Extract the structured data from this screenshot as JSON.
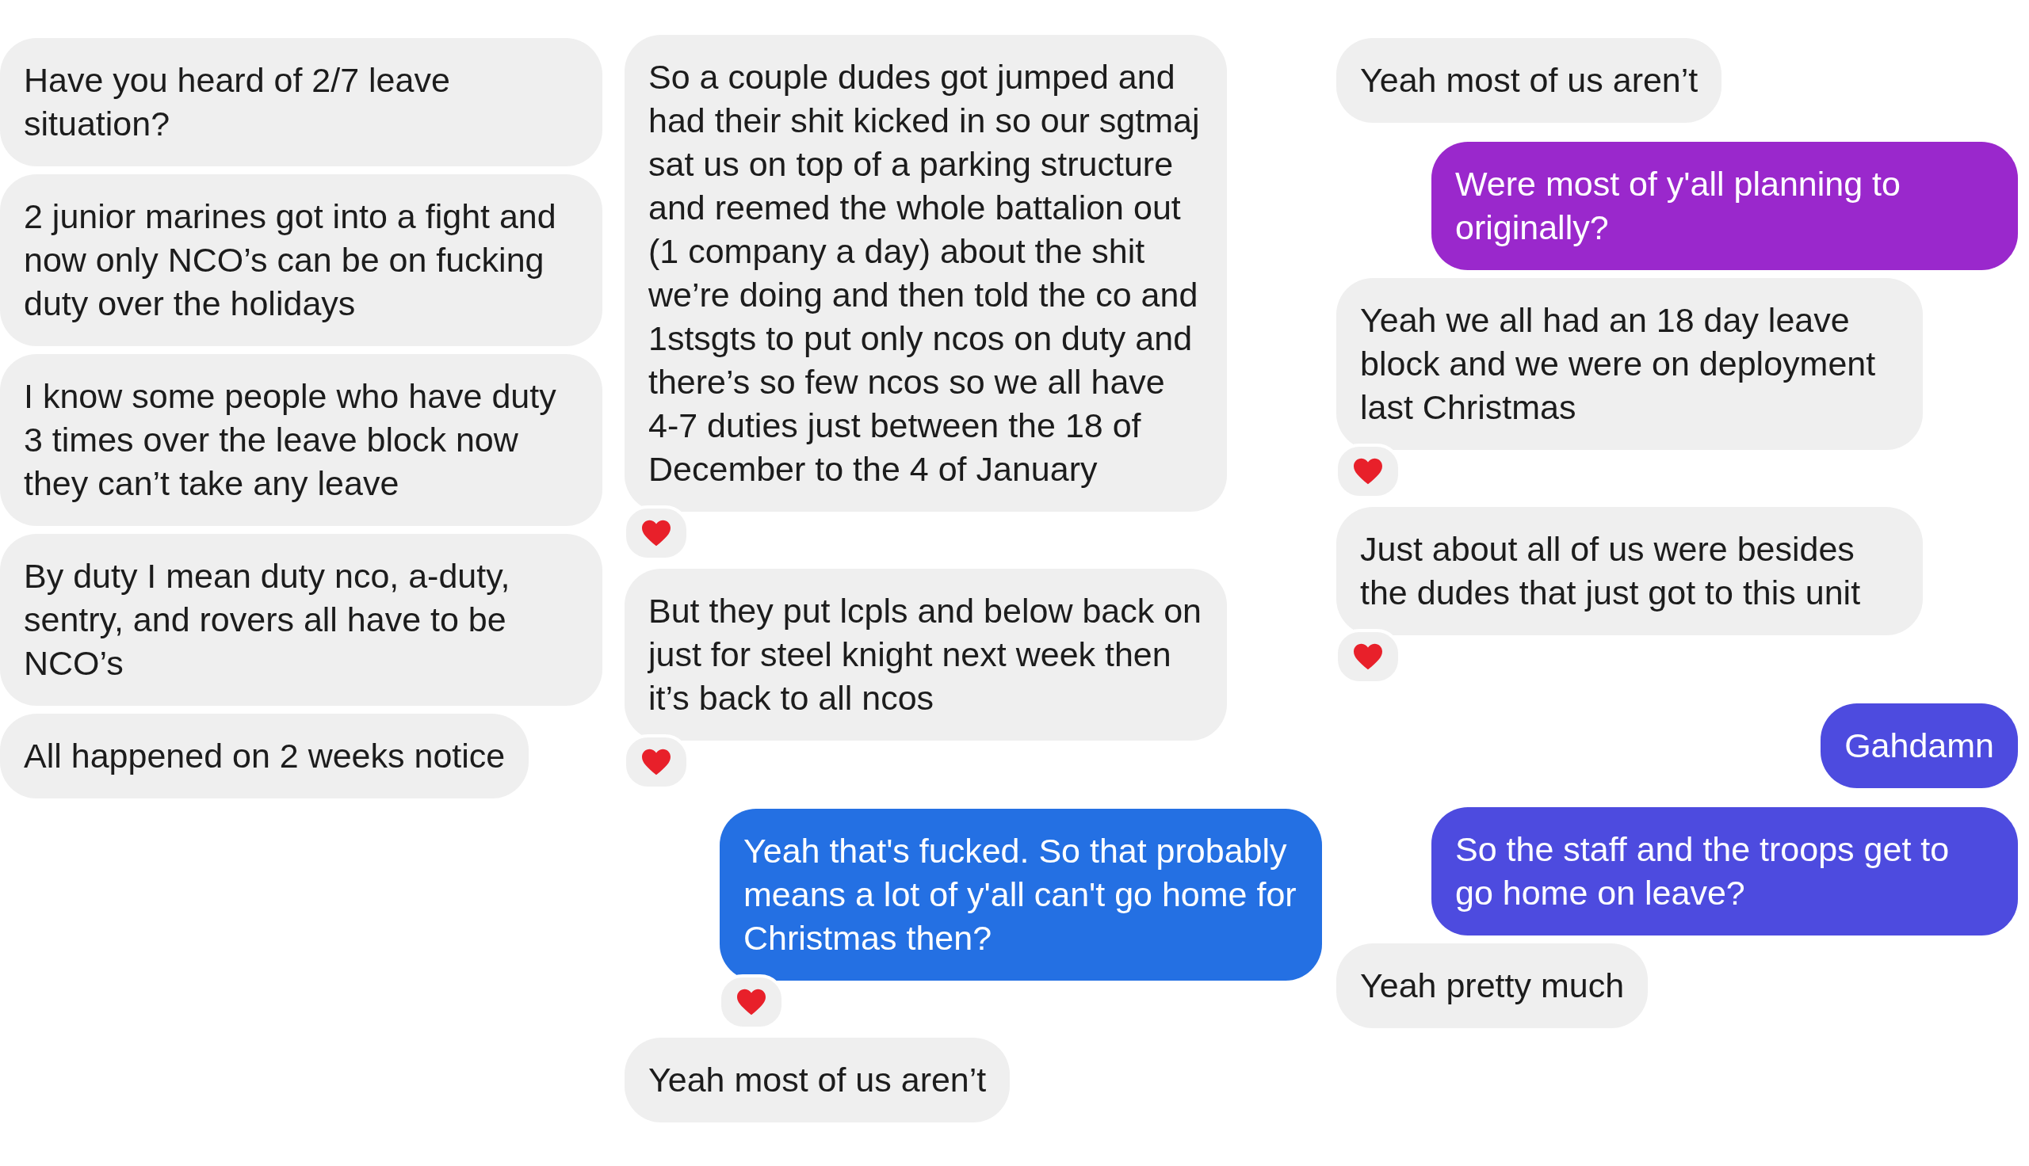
{
  "columns": [
    {
      "messages": [
        {
          "text": "Have you heard of 2/7 leave situation?",
          "kind": "incoming",
          "color": "#efefef",
          "reaction": false
        },
        {
          "text": "2 junior marines got into a fight and now only NCO’s can be on fucking duty over the holidays",
          "kind": "incoming",
          "color": "#efefef",
          "reaction": false
        },
        {
          "text": "I know some people who have duty 3 times over the leave block now they can’t take any leave",
          "kind": "incoming",
          "color": "#efefef",
          "reaction": false
        },
        {
          "text": "By duty I mean duty nco, a-duty, sentry, and rovers all have to be NCO’s",
          "kind": "incoming",
          "color": "#efefef",
          "reaction": false
        },
        {
          "text": "All happened on 2 weeks notice",
          "kind": "incoming",
          "color": "#efefef",
          "reaction": false
        }
      ]
    },
    {
      "messages": [
        {
          "text": "So a couple dudes got jumped and had their shit kicked in so our sgtmaj sat us on top of a parking structure and reemed the whole battalion out (1 company a day) about the shit we’re doing and then told the co and 1stsgts to put only ncos on duty and there’s so few ncos so we all have 4-7 duties just between the 18 of December to the 4 of January",
          "kind": "incoming",
          "color": "#efefef",
          "reaction": true
        },
        {
          "text": "But they put lcpls and below back on just for steel knight next week then it’s back to all ncos",
          "kind": "incoming",
          "color": "#efefef",
          "reaction": true
        },
        {
          "text": "Yeah that's fucked. So that probably means a lot of y'all can't go home for Christmas then?",
          "kind": "outgoing",
          "color": "#2470e3",
          "reaction": true
        },
        {
          "text": "Yeah most of us aren’t",
          "kind": "incoming",
          "color": "#efefef",
          "reaction": false
        }
      ]
    },
    {
      "messages": [
        {
          "text": "Yeah most of us aren’t",
          "kind": "incoming",
          "color": "#efefef",
          "reaction": false
        },
        {
          "text": "Were most of y'all planning to originally?",
          "kind": "outgoing",
          "color": "#9a28cc",
          "reaction": false
        },
        {
          "text": "Yeah we all had an 18 day leave block and we were on deployment last Christmas",
          "kind": "incoming",
          "color": "#efefef",
          "reaction": true
        },
        {
          "text": "Just about all of us were besides the dudes that just got to this unit",
          "kind": "incoming",
          "color": "#efefef",
          "reaction": true
        },
        {
          "text": "Gahdamn",
          "kind": "outgoing",
          "color": "#4d4bdf",
          "reaction": false
        },
        {
          "text": "So the staff and the troops get to go home on leave?",
          "kind": "outgoing",
          "color": "#4d4bdf",
          "reaction": false
        },
        {
          "text": "Yeah pretty much",
          "kind": "incoming",
          "color": "#efefef",
          "reaction": false
        }
      ]
    }
  ]
}
